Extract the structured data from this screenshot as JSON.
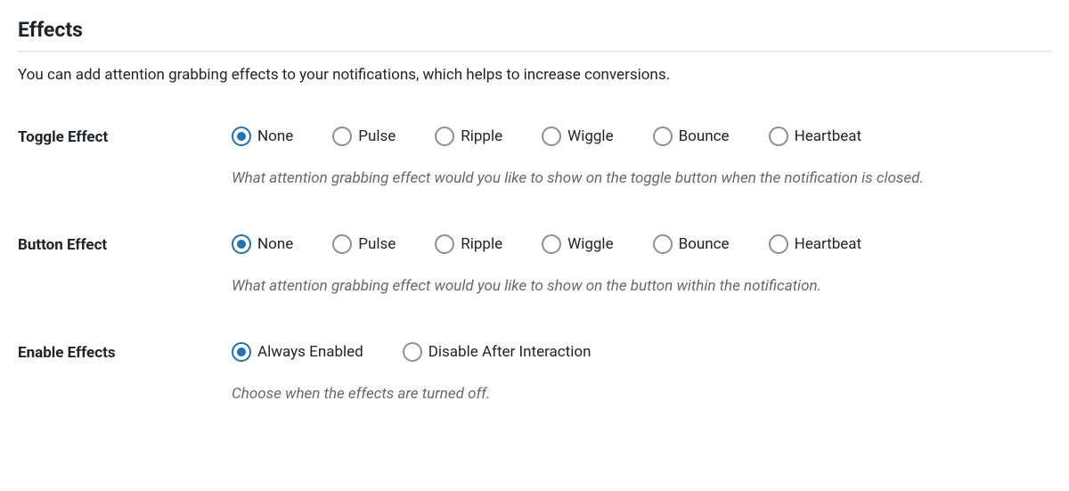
{
  "section": {
    "title": "Effects",
    "description": "You can add attention grabbing effects to your notifications, which helps to increase conversions."
  },
  "settings": {
    "toggle_effect": {
      "label": "Toggle Effect",
      "options": [
        "None",
        "Pulse",
        "Ripple",
        "Wiggle",
        "Bounce",
        "Heartbeat"
      ],
      "selected": "None",
      "help": "What attention grabbing effect would you like to show on the toggle button when the notification is closed."
    },
    "button_effect": {
      "label": "Button Effect",
      "options": [
        "None",
        "Pulse",
        "Ripple",
        "Wiggle",
        "Bounce",
        "Heartbeat"
      ],
      "selected": "None",
      "help": "What attention grabbing effect would you like to show on the button within the notification."
    },
    "enable_effects": {
      "label": "Enable Effects",
      "options": [
        "Always Enabled",
        "Disable After Interaction"
      ],
      "selected": "Always Enabled",
      "help": "Choose when the effects are turned off."
    }
  }
}
